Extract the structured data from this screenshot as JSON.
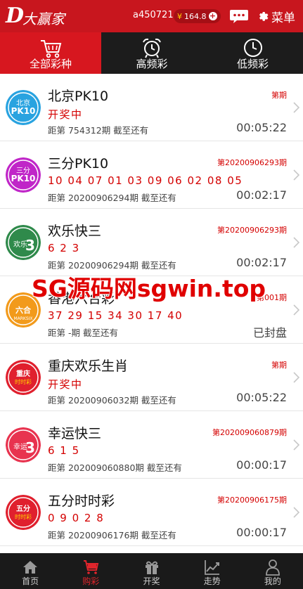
{
  "header": {
    "logo_letter": "D",
    "logo_text": "大赢家",
    "account": "a450721",
    "balance_currency": "¥",
    "balance": "164.8",
    "menu_label": "菜单"
  },
  "tabs": [
    {
      "label": "全部彩种",
      "icon": "basket-icon",
      "active": true
    },
    {
      "label": "高频彩",
      "icon": "alarm-clock-icon",
      "active": false
    },
    {
      "label": "低频彩",
      "icon": "clock-icon",
      "active": false
    }
  ],
  "games": [
    {
      "name": "北京PK10",
      "issue": "第期",
      "result": "开奖中",
      "countdown_label": "距第 754312期 截至还有",
      "countdown": "00:05:22",
      "icon": "beijing-pk10-icon",
      "icon_color": "#29a3e0"
    },
    {
      "name": "三分PK10",
      "issue": "第20200906293期",
      "result": "10 04 07 01 03 09 06 02 08 05",
      "countdown_label": "距第 20200906294期 截至还有",
      "countdown": "00:02:17",
      "icon": "sanfen-pk10-icon",
      "icon_color": "#c026c8"
    },
    {
      "name": "欢乐快三",
      "issue": "第20200906293期",
      "result": "6 2 3",
      "countdown_label": "距第 20200906294期 截至还有",
      "countdown": "00:02:17",
      "icon": "huanle-kuaisan-icon",
      "icon_color": "#2f8a4b"
    },
    {
      "name": "香港六合彩",
      "issue": "第001期",
      "result": "37 29 15 34 30 17 40",
      "countdown_label": "距第 -期 截至还有",
      "countdown": "已封盘",
      "icon": "hongkong-marksix-icon",
      "icon_color": "#f29a1b"
    },
    {
      "name": "重庆欢乐生肖",
      "issue": "第期",
      "result": "开奖中",
      "countdown_label": "距第 20200906032期 截至还有",
      "countdown": "00:05:22",
      "icon": "chongqing-shishicai-icon",
      "icon_color": "#e0202e"
    },
    {
      "name": "幸运快三",
      "issue": "第202009060879期",
      "result": "6 1 5",
      "countdown_label": "距第 202009060880期 截至还有",
      "countdown": "00:00:17",
      "icon": "xingyun-kuaisan-icon",
      "icon_color": "#e8334f"
    },
    {
      "name": "五分时时彩",
      "issue": "第20200906175期",
      "result": "0 9 0 2 8",
      "countdown_label": "距第 20200906176期 截至还有",
      "countdown": "00:00:17",
      "icon": "wufen-shishicai-icon",
      "icon_color": "#e0202e"
    }
  ],
  "watermark": "SG源码网sgwin.top",
  "bottom_nav": [
    {
      "label": "首页",
      "icon": "home-icon",
      "active": false
    },
    {
      "label": "购彩",
      "icon": "cart-icon",
      "active": true
    },
    {
      "label": "开奖",
      "icon": "gift-icon",
      "active": false
    },
    {
      "label": "走势",
      "icon": "trend-chart-icon",
      "active": false
    },
    {
      "label": "我的",
      "icon": "user-icon",
      "active": false
    }
  ],
  "colors": {
    "header_red": "#c8161e",
    "tab_active_red": "#d7171f",
    "dark_bg": "#1c1c1c",
    "accent_red": "#d40000"
  }
}
